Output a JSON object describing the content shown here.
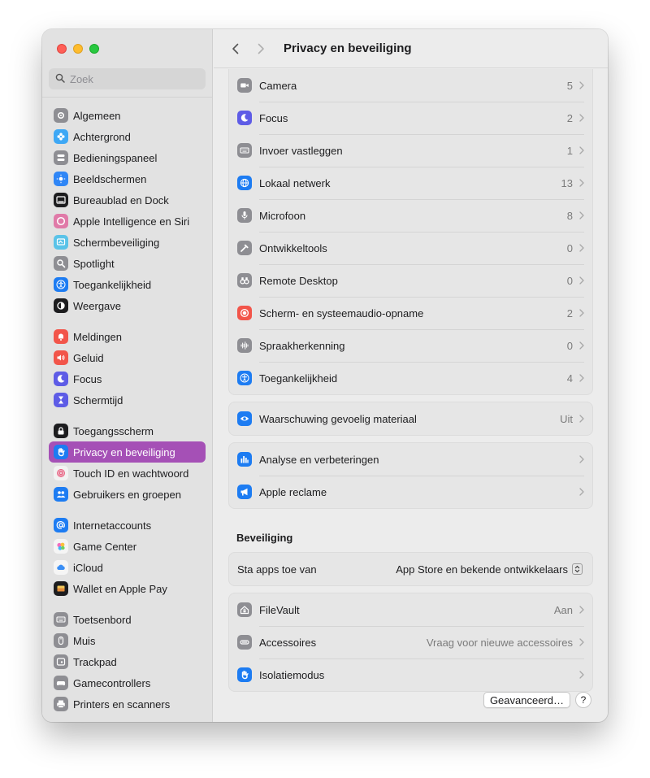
{
  "window": {
    "title": "Privacy en beveiliging"
  },
  "search": {
    "placeholder": "Zoek"
  },
  "sidebar": {
    "groups": [
      [
        {
          "label": "Algemeen",
          "icon": "gear-icon",
          "color": "#8e8e93"
        },
        {
          "label": "Achtergrond",
          "icon": "flower-icon",
          "color": "#3ea8f5"
        },
        {
          "label": "Bedieningspaneel",
          "icon": "toggles-icon",
          "color": "#8e8e93"
        },
        {
          "label": "Beeldschermen",
          "icon": "sun-icon",
          "color": "#2f86f6"
        },
        {
          "label": "Bureaublad en Dock",
          "icon": "dock-icon",
          "color": "#1d1d1f"
        },
        {
          "label": "Apple Intelligence en Siri",
          "icon": "siri-icon",
          "color": "#e07aa8"
        },
        {
          "label": "Schermbeveiliging",
          "icon": "screensaver-icon",
          "color": "#5ac3e8"
        },
        {
          "label": "Spotlight",
          "icon": "search-icon",
          "color": "#8e8e93"
        },
        {
          "label": "Toegankelijkheid",
          "icon": "accessibility-icon",
          "color": "#1d7cf2"
        },
        {
          "label": "Weergave",
          "icon": "appearance-icon",
          "color": "#1d1d1f"
        }
      ],
      [
        {
          "label": "Meldingen",
          "icon": "bell-icon",
          "color": "#f2554a"
        },
        {
          "label": "Geluid",
          "icon": "speaker-icon",
          "color": "#f2554a"
        },
        {
          "label": "Focus",
          "icon": "moon-icon",
          "color": "#5e5ce6"
        },
        {
          "label": "Schermtijd",
          "icon": "hourglass-icon",
          "color": "#5e5ce6"
        }
      ],
      [
        {
          "label": "Toegangsscherm",
          "icon": "lock-icon",
          "color": "#1d1d1f"
        },
        {
          "label": "Privacy en beveiliging",
          "icon": "hand-icon",
          "color": "#1d7cf2",
          "active": true
        },
        {
          "label": "Touch ID en wachtwoord",
          "icon": "fingerprint-icon",
          "color": "#f2f2f2"
        },
        {
          "label": "Gebruikers en groepen",
          "icon": "users-icon",
          "color": "#1d7cf2"
        }
      ],
      [
        {
          "label": "Internetaccounts",
          "icon": "at-icon",
          "color": "#1d7cf2"
        },
        {
          "label": "Game Center",
          "icon": "gamecenter-icon",
          "color": "#f5f5f5"
        },
        {
          "label": "iCloud",
          "icon": "cloud-icon",
          "color": "#f5f5f5"
        },
        {
          "label": "Wallet en Apple Pay",
          "icon": "wallet-icon",
          "color": "#1d1d1f"
        }
      ],
      [
        {
          "label": "Toetsenbord",
          "icon": "keyboard-icon",
          "color": "#8e8e93"
        },
        {
          "label": "Muis",
          "icon": "mouse-icon",
          "color": "#8e8e93"
        },
        {
          "label": "Trackpad",
          "icon": "trackpad-icon",
          "color": "#8e8e93"
        },
        {
          "label": "Gamecontrollers",
          "icon": "gamecontroller-icon",
          "color": "#8e8e93"
        },
        {
          "label": "Printers en scanners",
          "icon": "printer-icon",
          "color": "#8e8e93"
        }
      ]
    ]
  },
  "privacy": {
    "rows": [
      {
        "label": "Camera",
        "value": "5",
        "icon": "camera-icon",
        "color": "#8e8e93"
      },
      {
        "label": "Focus",
        "value": "2",
        "icon": "moon-icon",
        "color": "#5e5ce6"
      },
      {
        "label": "Invoer vastleggen",
        "value": "1",
        "icon": "keyboard-icon",
        "color": "#8e8e93"
      },
      {
        "label": "Lokaal netwerk",
        "value": "13",
        "icon": "globe-icon",
        "color": "#1d7cf2"
      },
      {
        "label": "Microfoon",
        "value": "8",
        "icon": "microphone-icon",
        "color": "#8e8e93"
      },
      {
        "label": "Ontwikkeltools",
        "value": "0",
        "icon": "hammer-icon",
        "color": "#8e8e93"
      },
      {
        "label": "Remote Desktop",
        "value": "0",
        "icon": "binoculars-icon",
        "color": "#8e8e93"
      },
      {
        "label": "Scherm- en systeemaudio-opname",
        "value": "2",
        "icon": "record-icon",
        "color": "#f2554a"
      },
      {
        "label": "Spraakherkenning",
        "value": "0",
        "icon": "waveform-icon",
        "color": "#8e8e93"
      },
      {
        "label": "Toegankelijkheid",
        "value": "4",
        "icon": "accessibility-icon",
        "color": "#1d7cf2"
      }
    ]
  },
  "sensitive": {
    "label": "Waarschuwing gevoelig materiaal",
    "value": "Uit",
    "icon": "eye-icon",
    "color": "#1d7cf2"
  },
  "analytics": [
    {
      "label": "Analyse en verbeteringen",
      "icon": "chart-icon",
      "color": "#1d7cf2"
    },
    {
      "label": "Apple reclame",
      "icon": "megaphone-icon",
      "color": "#1d7cf2"
    }
  ],
  "security": {
    "title": "Beveiliging",
    "allow_label": "Sta apps toe van",
    "allow_value": "App Store en bekende ontwikkelaars",
    "rows": [
      {
        "label": "FileVault",
        "value": "Aan",
        "icon": "house-lock-icon",
        "color": "#8e8e93"
      },
      {
        "label": "Accessoires",
        "value": "Vraag voor nieuwe accessoires",
        "icon": "accessory-icon",
        "color": "#8e8e93"
      },
      {
        "label": "Isolatiemodus",
        "value": "",
        "icon": "hand-icon",
        "color": "#1d7cf2"
      }
    ]
  },
  "footer": {
    "advanced_label": "Geavanceerd…",
    "help_label": "?"
  }
}
